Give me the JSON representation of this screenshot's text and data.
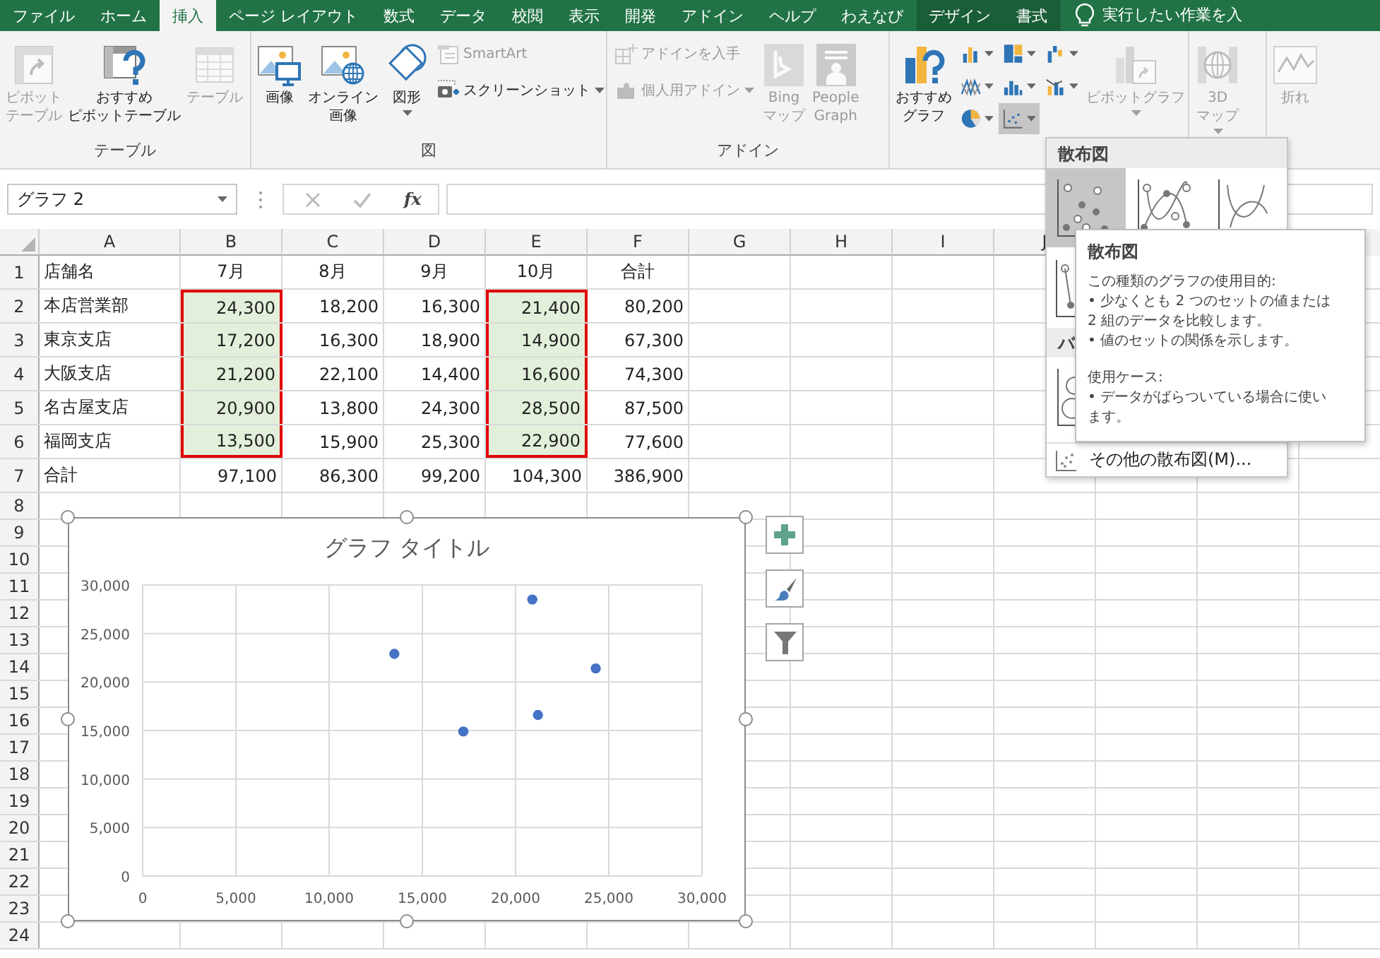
{
  "tabs": [
    {
      "label": "ファイル",
      "selected": false,
      "contextual": false
    },
    {
      "label": "ホーム",
      "selected": false,
      "contextual": false
    },
    {
      "label": "挿入",
      "selected": true,
      "contextual": false
    },
    {
      "label": "ページ レイアウト",
      "selected": false,
      "contextual": false
    },
    {
      "label": "数式",
      "selected": false,
      "contextual": false
    },
    {
      "label": "データ",
      "selected": false,
      "contextual": false
    },
    {
      "label": "校閲",
      "selected": false,
      "contextual": false
    },
    {
      "label": "表示",
      "selected": false,
      "contextual": false
    },
    {
      "label": "開発",
      "selected": false,
      "contextual": false
    },
    {
      "label": "アドイン",
      "selected": false,
      "contextual": false
    },
    {
      "label": "ヘルプ",
      "selected": false,
      "contextual": false
    },
    {
      "label": "わえなび",
      "selected": false,
      "contextual": false
    },
    {
      "label": "デザイン",
      "selected": false,
      "contextual": true
    },
    {
      "label": "書式",
      "selected": false,
      "contextual": true
    }
  ],
  "tell_me": {
    "text": "実行したい作業を入"
  },
  "ribbon": {
    "groups": [
      {
        "label": "テーブル",
        "items": [
          {
            "kind": "large",
            "lines": [
              "ピボット",
              "テーブル"
            ],
            "disabled": true
          },
          {
            "kind": "large",
            "lines": [
              "おすすめ",
              "ピボットテーブル"
            ],
            "disabled": false
          },
          {
            "kind": "large",
            "lines": [
              "テーブル"
            ],
            "disabled": true
          }
        ]
      },
      {
        "label": "図",
        "items": [
          {
            "kind": "large",
            "lines": [
              "画像"
            ],
            "disabled": false
          },
          {
            "kind": "large",
            "lines": [
              "オンライン",
              "画像"
            ],
            "disabled": false
          },
          {
            "kind": "large",
            "lines": [
              "図形"
            ],
            "disabled": false,
            "dropdown": true
          },
          {
            "kind": "stack",
            "items": [
              {
                "label": "SmartArt",
                "disabled": true,
                "dropdown": false
              },
              {
                "label": "スクリーンショット",
                "disabled": false,
                "dropdown": true
              }
            ]
          }
        ]
      },
      {
        "label": "アドイン",
        "items": [
          {
            "kind": "stack",
            "items": [
              {
                "label": "アドインを入手",
                "disabled": true,
                "dropdown": false
              },
              {
                "label": "個人用アドイン",
                "disabled": true,
                "dropdown": true
              }
            ]
          },
          {
            "kind": "large",
            "lines": [
              "Bing",
              "マップ"
            ],
            "disabled": true
          },
          {
            "kind": "large",
            "lines": [
              "People",
              "Graph"
            ],
            "disabled": true
          }
        ]
      },
      {
        "items": [
          {
            "kind": "large",
            "lines": [
              "おすすめ",
              "グラフ"
            ],
            "disabled": false
          },
          {
            "kind": "grid",
            "buttons": [
              {
                "selected": false
              },
              {
                "selected": false
              },
              {
                "selected": false
              },
              {
                "selected": false
              },
              {
                "selected": false
              },
              {
                "selected": false
              },
              {
                "selected": false
              },
              {
                "selected": true
              }
            ]
          },
          {
            "kind": "large",
            "lines": [
              "ピボットグラフ"
            ],
            "disabled": true,
            "dropdown": true
          }
        ]
      },
      {
        "items": [
          {
            "kind": "large",
            "lines": [
              "3D",
              "マップ"
            ],
            "disabled": true,
            "dropdown": true
          }
        ]
      },
      {
        "items": [
          {
            "kind": "large",
            "lines": [
              "折れ"
            ],
            "disabled": true
          }
        ]
      }
    ]
  },
  "formula_bar": {
    "name_box": "グラフ 2",
    "function_button": "fx"
  },
  "sheet": {
    "columns": [
      "A",
      "B",
      "C",
      "D",
      "E",
      "F",
      "G",
      "H",
      "I",
      "J"
    ],
    "rows": [
      {
        "number": "1",
        "cells": [
          {
            "text": "店舗名",
            "kind": "text",
            "highlighted": false
          },
          {
            "text": "7月",
            "kind": "header",
            "highlighted": false
          },
          {
            "text": "8月",
            "kind": "header",
            "highlighted": false
          },
          {
            "text": "9月",
            "kind": "header",
            "highlighted": false
          },
          {
            "text": "10月",
            "kind": "header",
            "highlighted": false
          },
          {
            "text": "合計",
            "kind": "header",
            "highlighted": false
          }
        ]
      },
      {
        "number": "2",
        "cells": [
          {
            "text": "本店営業部",
            "kind": "text",
            "highlighted": false
          },
          {
            "text": "24,300",
            "kind": "number",
            "highlighted": true
          },
          {
            "text": "18,200",
            "kind": "number",
            "highlighted": false
          },
          {
            "text": "16,300",
            "kind": "number",
            "highlighted": false
          },
          {
            "text": "21,400",
            "kind": "number",
            "highlighted": true
          },
          {
            "text": "80,200",
            "kind": "number",
            "highlighted": false
          }
        ]
      },
      {
        "number": "3",
        "cells": [
          {
            "text": "東京支店",
            "kind": "text",
            "highlighted": false
          },
          {
            "text": "17,200",
            "kind": "number",
            "highlighted": true
          },
          {
            "text": "16,300",
            "kind": "number",
            "highlighted": false
          },
          {
            "text": "18,900",
            "kind": "number",
            "highlighted": false
          },
          {
            "text": "14,900",
            "kind": "number",
            "highlighted": true
          },
          {
            "text": "67,300",
            "kind": "number",
            "highlighted": false
          }
        ]
      },
      {
        "number": "4",
        "cells": [
          {
            "text": "大阪支店",
            "kind": "text",
            "highlighted": false
          },
          {
            "text": "21,200",
            "kind": "number",
            "highlighted": true
          },
          {
            "text": "22,100",
            "kind": "number",
            "highlighted": false
          },
          {
            "text": "14,400",
            "kind": "number",
            "highlighted": false
          },
          {
            "text": "16,600",
            "kind": "number",
            "highlighted": true
          },
          {
            "text": "74,300",
            "kind": "number",
            "highlighted": false
          }
        ]
      },
      {
        "number": "5",
        "cells": [
          {
            "text": "名古屋支店",
            "kind": "text",
            "highlighted": false
          },
          {
            "text": "20,900",
            "kind": "number",
            "highlighted": true
          },
          {
            "text": "13,800",
            "kind": "number",
            "highlighted": false
          },
          {
            "text": "24,300",
            "kind": "number",
            "highlighted": false
          },
          {
            "text": "28,500",
            "kind": "number",
            "highlighted": true
          },
          {
            "text": "87,500",
            "kind": "number",
            "highlighted": false
          }
        ]
      },
      {
        "number": "6",
        "cells": [
          {
            "text": "福岡支店",
            "kind": "text",
            "highlighted": false
          },
          {
            "text": "13,500",
            "kind": "number",
            "highlighted": true
          },
          {
            "text": "15,900",
            "kind": "number",
            "highlighted": false
          },
          {
            "text": "25,300",
            "kind": "number",
            "highlighted": false
          },
          {
            "text": "22,900",
            "kind": "number",
            "highlighted": true
          },
          {
            "text": "77,600",
            "kind": "number",
            "highlighted": false
          }
        ]
      },
      {
        "number": "7",
        "cells": [
          {
            "text": "合計",
            "kind": "text",
            "highlighted": false
          },
          {
            "text": "97,100",
            "kind": "number",
            "highlighted": false
          },
          {
            "text": "86,300",
            "kind": "number",
            "highlighted": false
          },
          {
            "text": "99,200",
            "kind": "number",
            "highlighted": false
          },
          {
            "text": "104,300",
            "kind": "number",
            "highlighted": false
          },
          {
            "text": "386,900",
            "kind": "number",
            "highlighted": false
          }
        ]
      },
      {
        "number": "8"
      },
      {
        "number": "9"
      },
      {
        "number": "10"
      },
      {
        "number": "11"
      },
      {
        "number": "12"
      },
      {
        "number": "13"
      },
      {
        "number": "14"
      },
      {
        "number": "15"
      },
      {
        "number": "16"
      },
      {
        "number": "17"
      },
      {
        "number": "18"
      },
      {
        "number": "19"
      },
      {
        "number": "20"
      },
      {
        "number": "21"
      },
      {
        "number": "22"
      },
      {
        "number": "23"
      },
      {
        "number": "24"
      }
    ]
  },
  "chart": {
    "chart_data": {
      "type": "scatter",
      "title": "グラフ タイトル",
      "grid": true,
      "x": [
        24300,
        17200,
        21200,
        20900,
        13500
      ],
      "series": [
        {
          "color": "#4472c4",
          "values": [
            21400,
            14900,
            16600,
            28500,
            22900
          ]
        }
      ],
      "xlim": [
        0,
        30000
      ],
      "ylim": [
        0,
        30000
      ],
      "xticks": [
        {
          "value": 0,
          "label": "0"
        },
        {
          "value": 5000,
          "label": "5,000"
        },
        {
          "value": 10000,
          "label": "10,000"
        },
        {
          "value": 15000,
          "label": "15,000"
        },
        {
          "value": 20000,
          "label": "20,000"
        },
        {
          "value": 25000,
          "label": "25,000"
        },
        {
          "value": 30000,
          "label": "30,000"
        }
      ],
      "yticks": [
        {
          "value": 0,
          "label": "0"
        },
        {
          "value": 5000,
          "label": "5,000"
        },
        {
          "value": 10000,
          "label": "10,000"
        },
        {
          "value": 15000,
          "label": "15,000"
        },
        {
          "value": 20000,
          "label": "20,000"
        },
        {
          "value": 25000,
          "label": "25,000"
        },
        {
          "value": 30000,
          "label": "30,000"
        }
      ]
    }
  },
  "scatter_menu": {
    "sections": [
      {
        "label": "散布図",
        "options": [
          {
            "selected": true
          },
          {
            "selected": false
          },
          {
            "selected": false
          },
          {
            "selected": false
          }
        ]
      },
      {
        "label": "バ",
        "options": [
          {
            "selected": false
          }
        ]
      }
    ],
    "footer": "その他の散布図(M)..."
  },
  "tooltip": {
    "title": "散布図",
    "paragraphs": [
      [
        "この種類のグラフの使用目的:",
        "• 少なくとも 2 つのセットの値または",
        "2 組のデータを比較します。",
        "• 値のセットの関係を示します。"
      ],
      [
        "使用ケース:",
        "• データがばらついている場合に使い",
        "ます。"
      ]
    ]
  }
}
